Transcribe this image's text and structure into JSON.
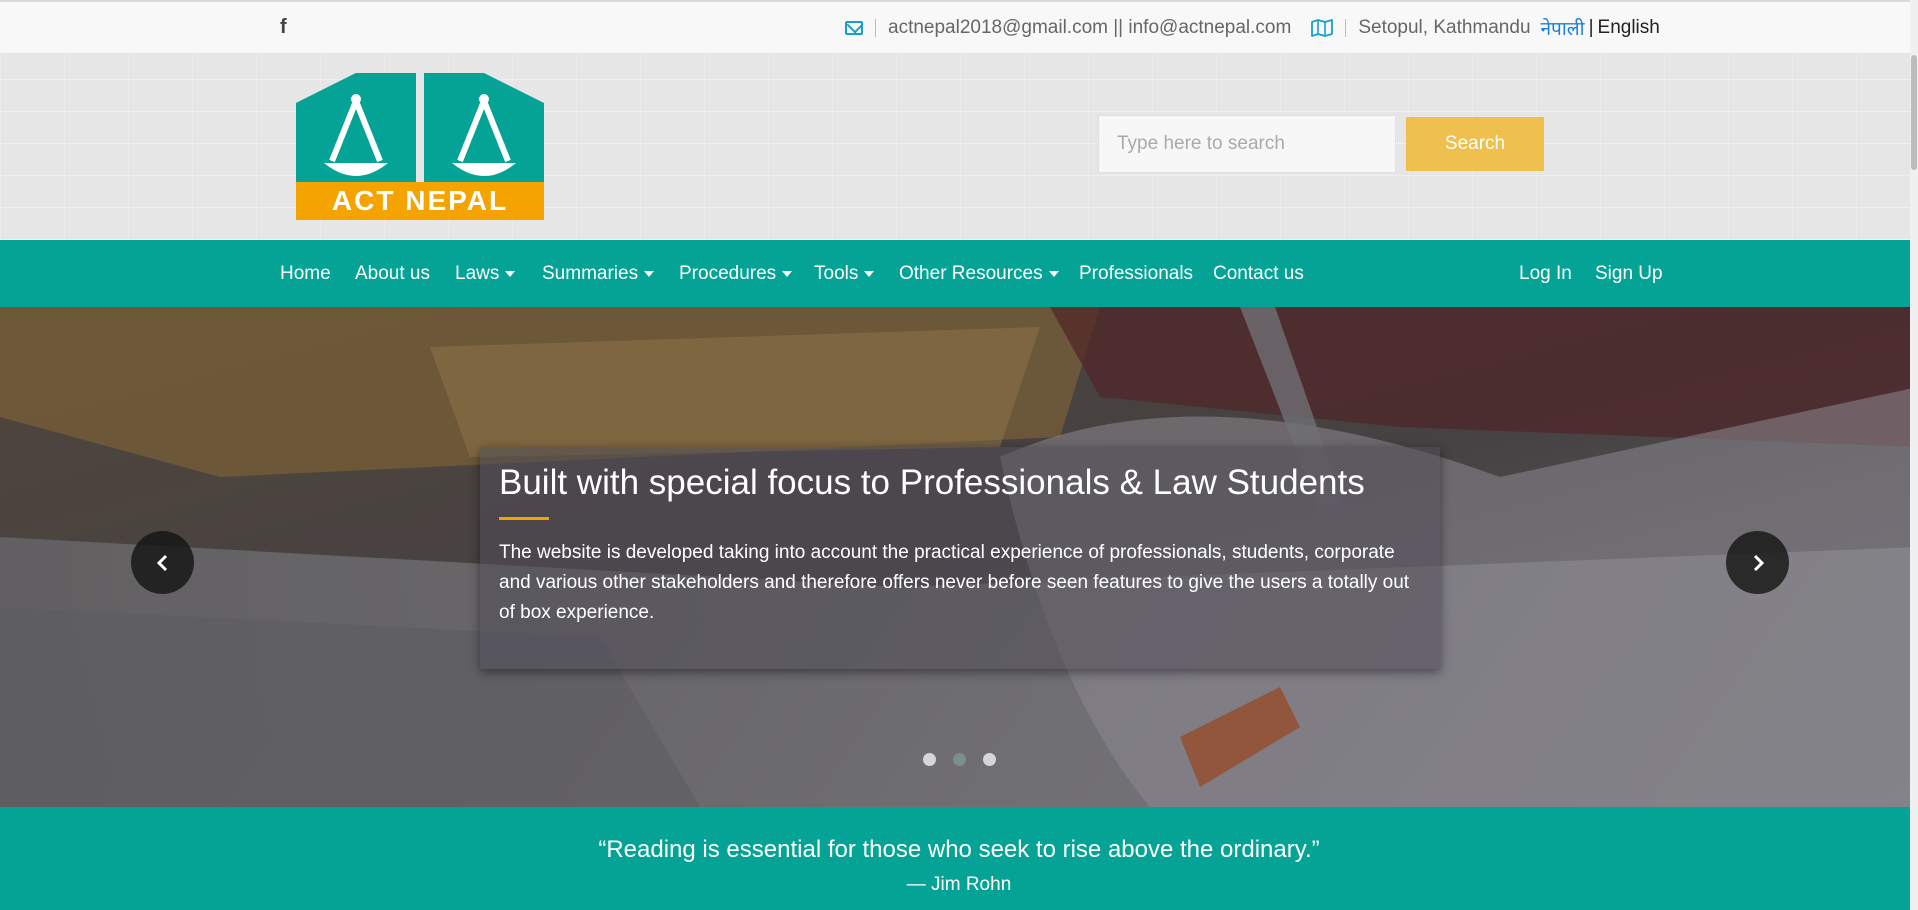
{
  "topbar": {
    "facebook_icon": "facebook-icon",
    "email_icon": "envelope-icon",
    "email_text": "actnepal2018@gmail.com || info@actnepal.com",
    "map_icon": "map-icon",
    "address": "Setopul, Kathmandu",
    "lang_nepali": "नेपाली",
    "lang_pipe": "|",
    "lang_english": "English"
  },
  "header": {
    "logo_text": "ACT NEPAL",
    "search_placeholder": "Type here to search",
    "search_button": "Search",
    "colors": {
      "logo_teal": "#04a395",
      "logo_orange": "#f5a300",
      "search_button": "#efc04d"
    }
  },
  "nav": {
    "items": [
      {
        "label": "Home",
        "dropdown": false
      },
      {
        "label": "About us",
        "dropdown": false
      },
      {
        "label": "Laws",
        "dropdown": true
      },
      {
        "label": "Summaries",
        "dropdown": true
      },
      {
        "label": "Procedures",
        "dropdown": true
      },
      {
        "label": "Tools",
        "dropdown": true
      },
      {
        "label": "Other Resources",
        "dropdown": true
      },
      {
        "label": "Professionals",
        "dropdown": false
      },
      {
        "label": "Contact us",
        "dropdown": false
      }
    ],
    "login": "Log In",
    "signup": "Sign Up",
    "color": "#04a395"
  },
  "hero": {
    "title": "Built with special focus to Professionals & Law Students",
    "text": "The website is developed taking into account the practical experience of professionals, students, corporate and various other stakeholders and therefore offers never before seen features to give the users a totally out of box experience.",
    "prev_icon": "chevron-left-icon",
    "next_icon": "chevron-right-icon",
    "slides": 3,
    "active_slide": 2
  },
  "quote": {
    "text": "“Reading is essential for those who seek to rise above the ordinary.”",
    "author": "— Jim Rohn"
  }
}
